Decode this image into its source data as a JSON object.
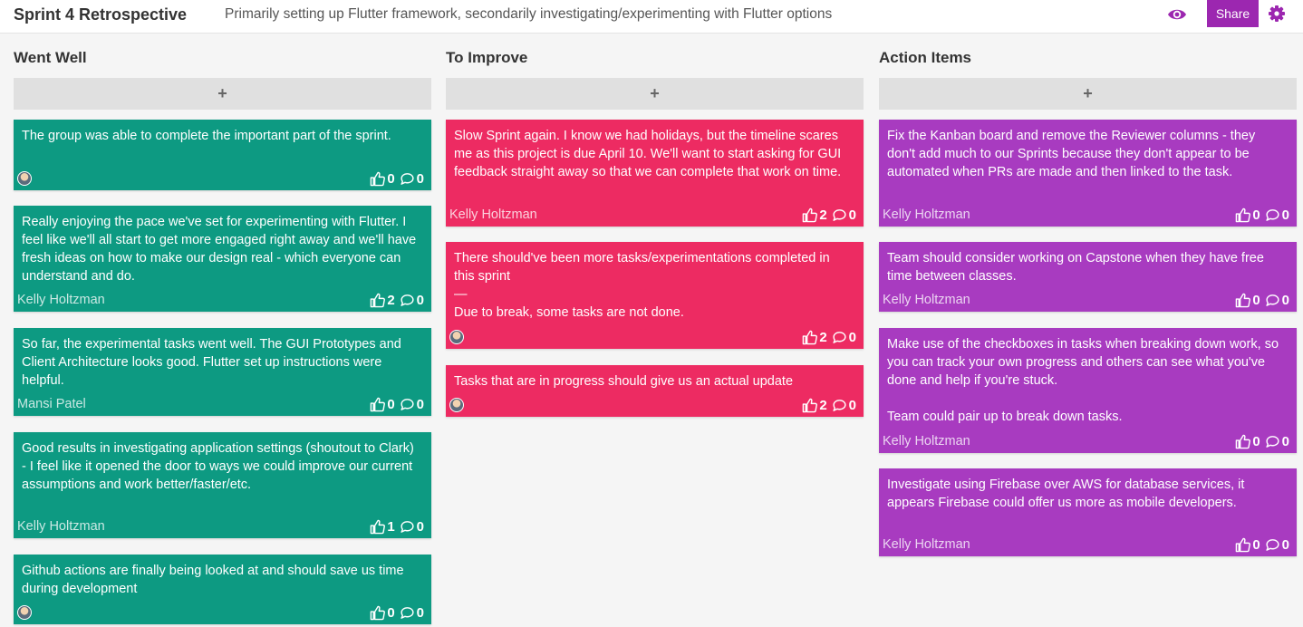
{
  "header": {
    "title": "Sprint 4 Retrospective",
    "subtitle": "Primarily setting up Flutter framework, secondarily investigating/experimenting with Flutter options",
    "share_label": "Share"
  },
  "columns": [
    {
      "title": "Went Well",
      "add_label": "+",
      "color": "#0d9a82",
      "cards": [
        {
          "text": "The group was able to complete the important part of the sprint.",
          "author": "",
          "likes": "0",
          "comments": "0"
        },
        {
          "text": "Really enjoying the pace we've set for experimenting with Flutter. I feel like we'll all start to get more engaged right away and we'll have fresh ideas on how to make our design real - which everyone can understand and do.",
          "author": "Kelly Holtzman",
          "likes": "2",
          "comments": "0"
        },
        {
          "text": "So far, the experimental tasks went well. The GUI Prototypes and Client Architecture looks good. Flutter set up instructions were helpful.",
          "author": "Mansi Patel",
          "likes": "0",
          "comments": "0"
        },
        {
          "text": "Good results in investigating application settings (shoutout to Clark) - I feel like it opened the door to ways we could improve our current assumptions and work better/faster/etc.",
          "author": "Kelly Holtzman",
          "likes": "1",
          "comments": "0"
        },
        {
          "text": "Github actions are finally being looked at and should save us time during development",
          "author": "",
          "likes": "0",
          "comments": "0"
        }
      ]
    },
    {
      "title": "To Improve",
      "add_label": "+",
      "color": "#ed2b62",
      "cards": [
        {
          "text": "Slow Sprint again. I know we had holidays, but the timeline scares me as this project is due April 10. We'll want to start asking for GUI feedback straight away so that we can complete that work on time.",
          "author": "Kelly Holtzman",
          "likes": "2",
          "comments": "0"
        },
        {
          "text": "There should've been more tasks/experimentations completed in this sprint\n—\nDue to break, some tasks are not done.",
          "author": "",
          "likes": "2",
          "comments": "0"
        },
        {
          "text": "Tasks that are in progress should give us an actual update",
          "author": "",
          "likes": "2",
          "comments": "0"
        }
      ]
    },
    {
      "title": "Action Items",
      "add_label": "+",
      "color": "#a83bc0",
      "cards": [
        {
          "text": "Fix the Kanban board and remove the Reviewer columns - they don't add much to our Sprints because they don't appear to be automated when PRs are made and then linked to the task.",
          "author": "Kelly Holtzman",
          "likes": "0",
          "comments": "0"
        },
        {
          "text": "Team should consider working on Capstone when they have free time between classes.",
          "author": "Kelly Holtzman",
          "likes": "0",
          "comments": "0"
        },
        {
          "text": "Make use of the checkboxes in tasks when breaking down work, so you can track your own progress and others can see what you've done and help if you're stuck.\n\nTeam could pair up to break down tasks.",
          "author": "Kelly Holtzman",
          "likes": "0",
          "comments": "0"
        },
        {
          "text": "Investigate using Firebase over AWS for database services, it appears Firebase could offer us more as mobile developers.",
          "author": "Kelly Holtzman",
          "likes": "0",
          "comments": "0"
        }
      ]
    }
  ]
}
